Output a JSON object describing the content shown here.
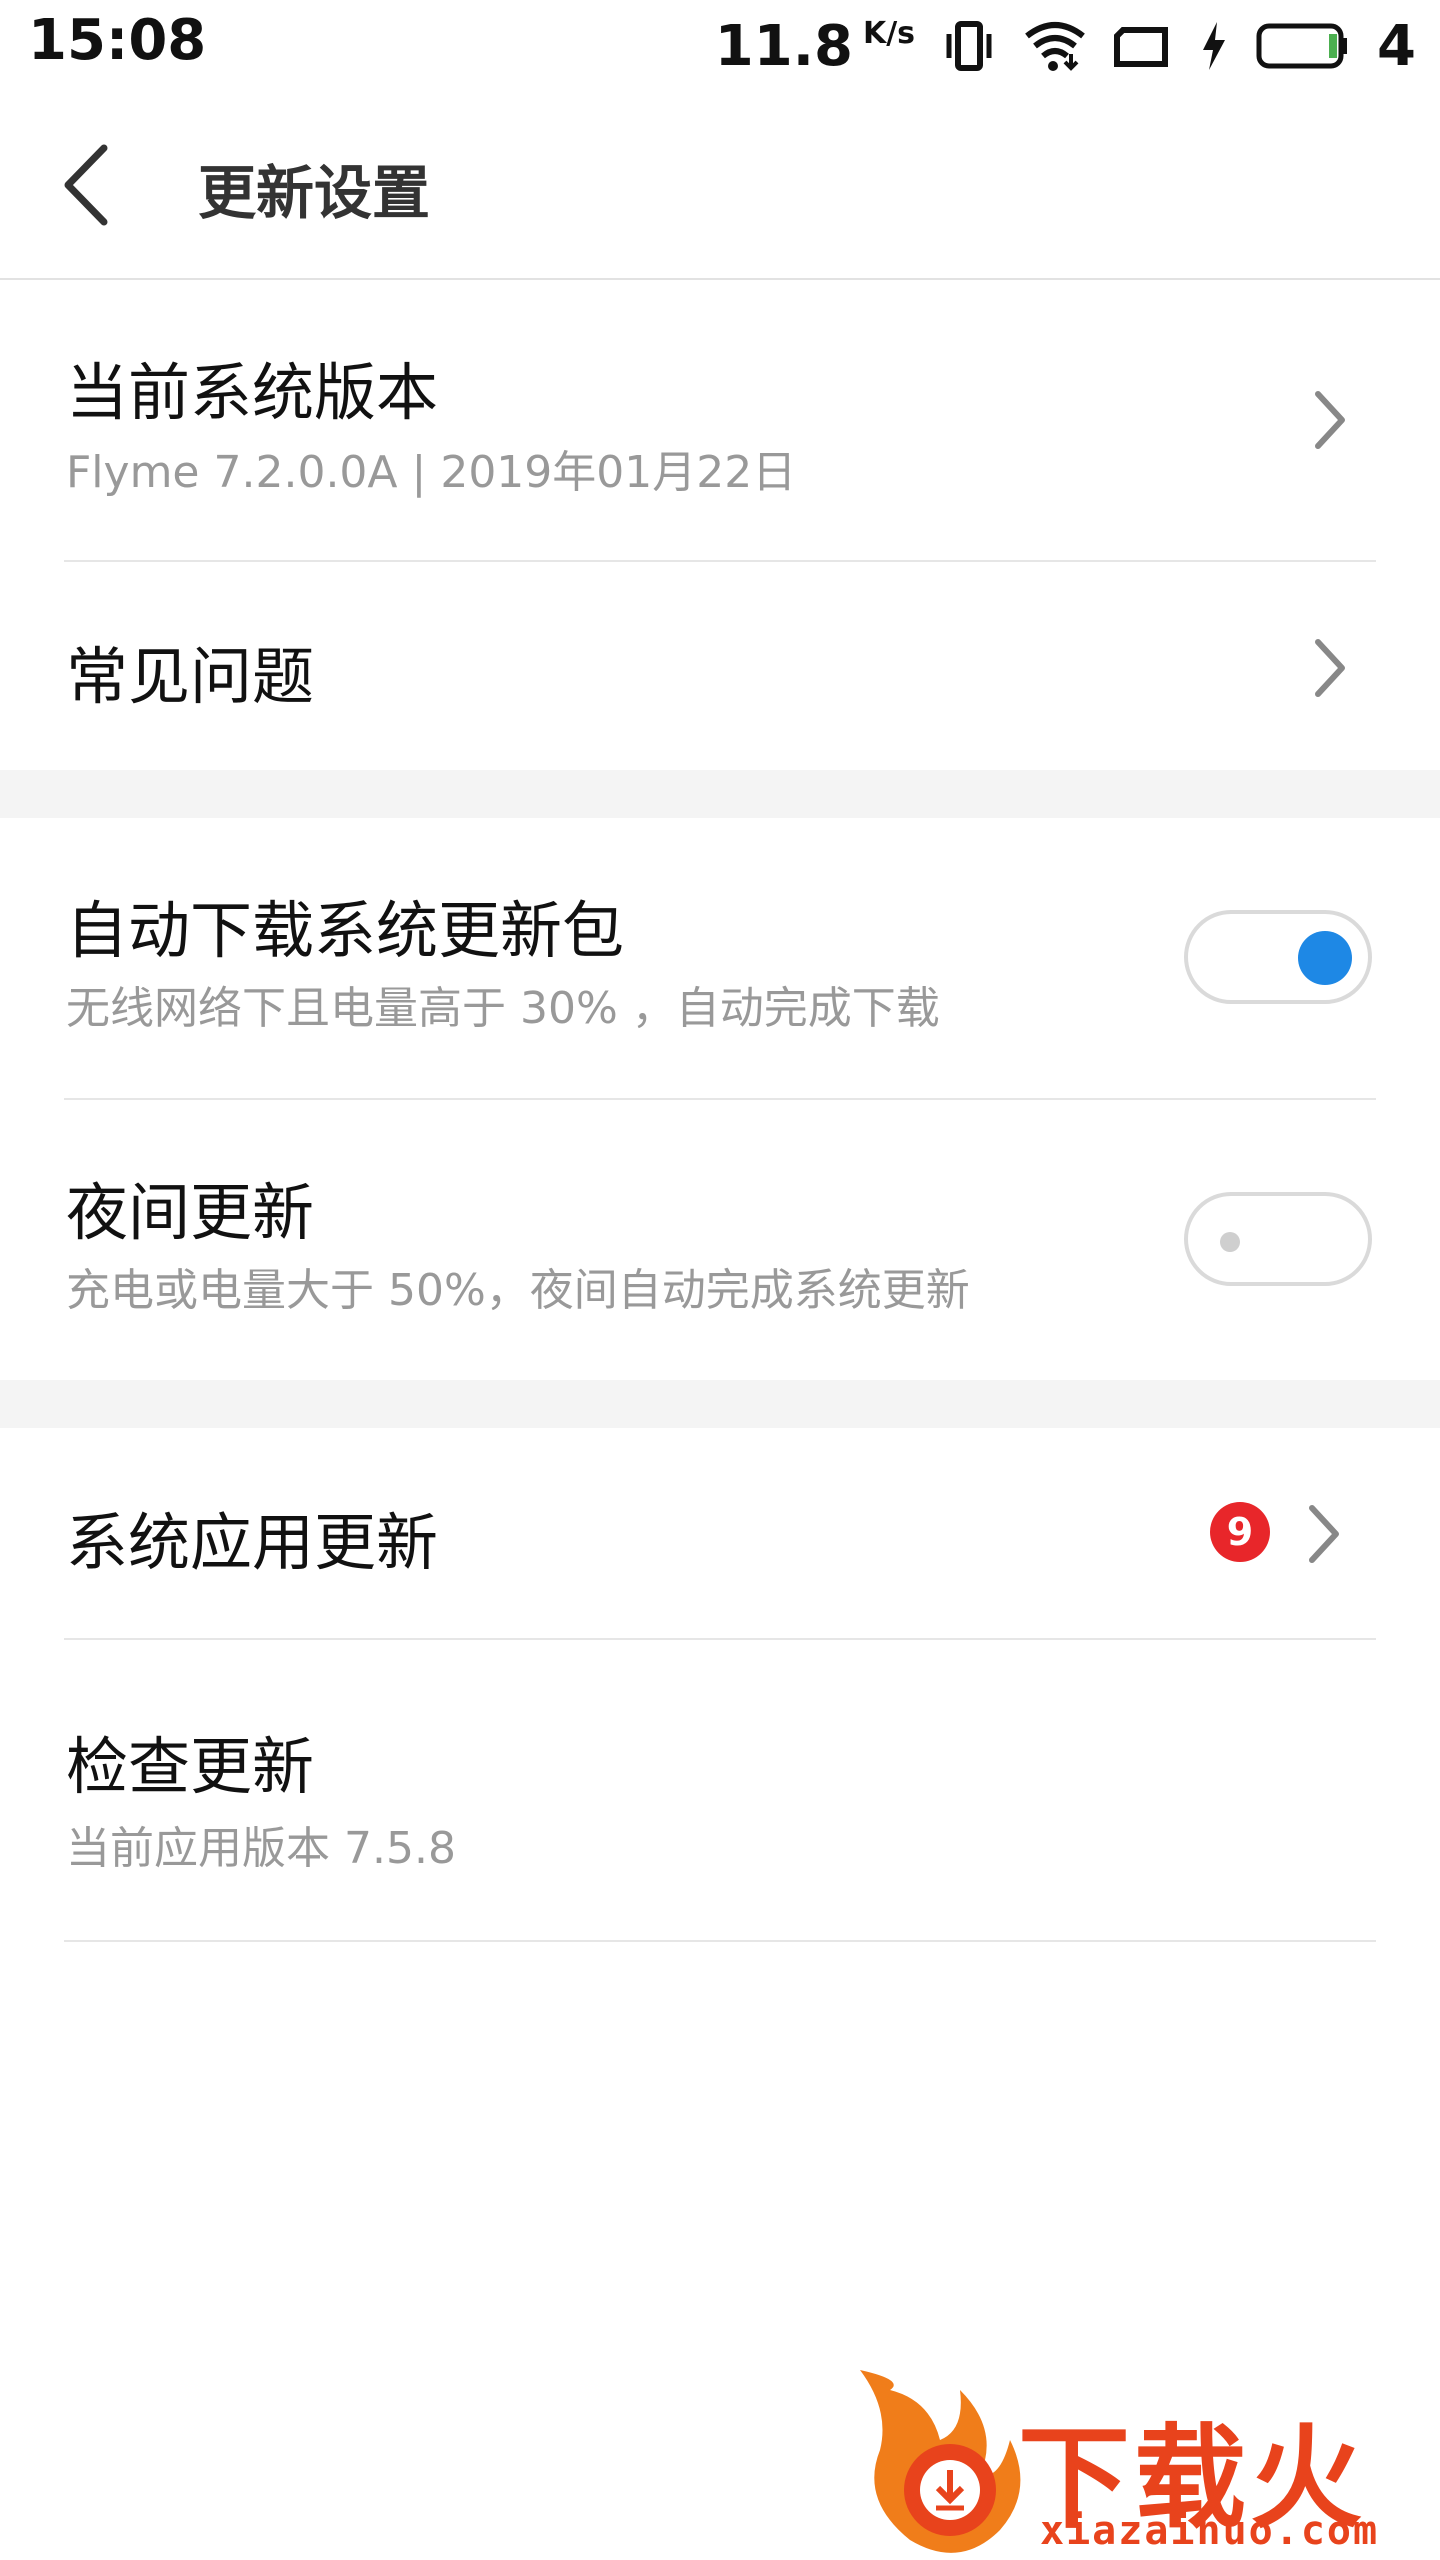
{
  "status_bar": {
    "time": "15:08",
    "speed": "11.8",
    "speed_unit": "K/s",
    "battery_level": "4"
  },
  "header": {
    "title": "更新设置"
  },
  "items": {
    "system_version": {
      "title": "当前系统版本",
      "subtitle": "Flyme 7.2.0.0A | 2019年01月22日"
    },
    "faq": {
      "title": "常见问题"
    },
    "auto_download": {
      "title": "自动下载系统更新包",
      "subtitle": "无线网络下且电量高于 30% ，自动完成下载",
      "enabled": true
    },
    "night_update": {
      "title": "夜间更新",
      "subtitle": "充电或电量大于 50%，夜间自动完成系统更新",
      "enabled": false
    },
    "app_updates": {
      "title": "系统应用更新",
      "badge": "9"
    },
    "check_update": {
      "title": "检查更新",
      "subtitle": "当前应用版本 7.5.8"
    }
  },
  "watermark": {
    "brand": "下载火",
    "url": "xiazaihuo.com"
  },
  "colors": {
    "accent": "#1e88e5",
    "badge": "#e8262a",
    "watermark": "#e8431c"
  }
}
